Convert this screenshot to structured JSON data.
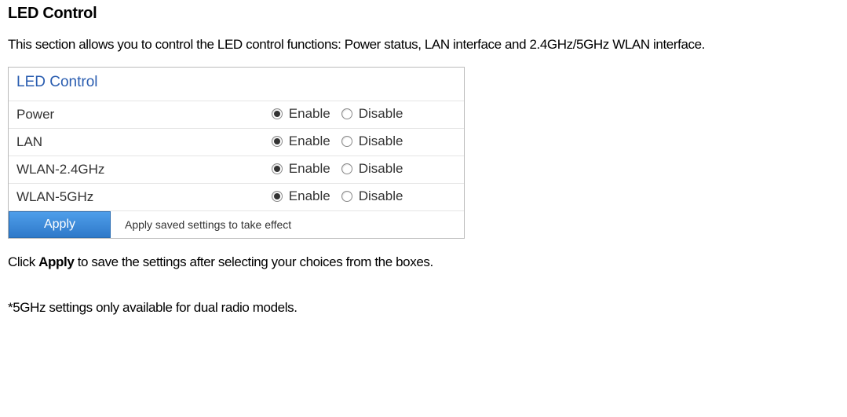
{
  "heading": "LED Control",
  "intro": "This section allows you to control the LED control functions: Power status, LAN interface and 2.4GHz/5GHz WLAN interface.",
  "panel": {
    "title": "LED Control",
    "enable_label": "Enable",
    "disable_label": "Disable",
    "rows": [
      {
        "label": "Power",
        "selected": "enable"
      },
      {
        "label": "LAN",
        "selected": "enable"
      },
      {
        "label": "WLAN-2.4GHz",
        "selected": "enable"
      },
      {
        "label": "WLAN-5GHz",
        "selected": "enable"
      }
    ],
    "apply_button": "Apply",
    "apply_note": "Apply saved settings to take effect"
  },
  "click_apply_pre": "Click ",
  "click_apply_bold": "Apply",
  "click_apply_post": " to save the settings after selecting your choices from the boxes.",
  "footnote": "*5GHz settings only available for dual radio models."
}
